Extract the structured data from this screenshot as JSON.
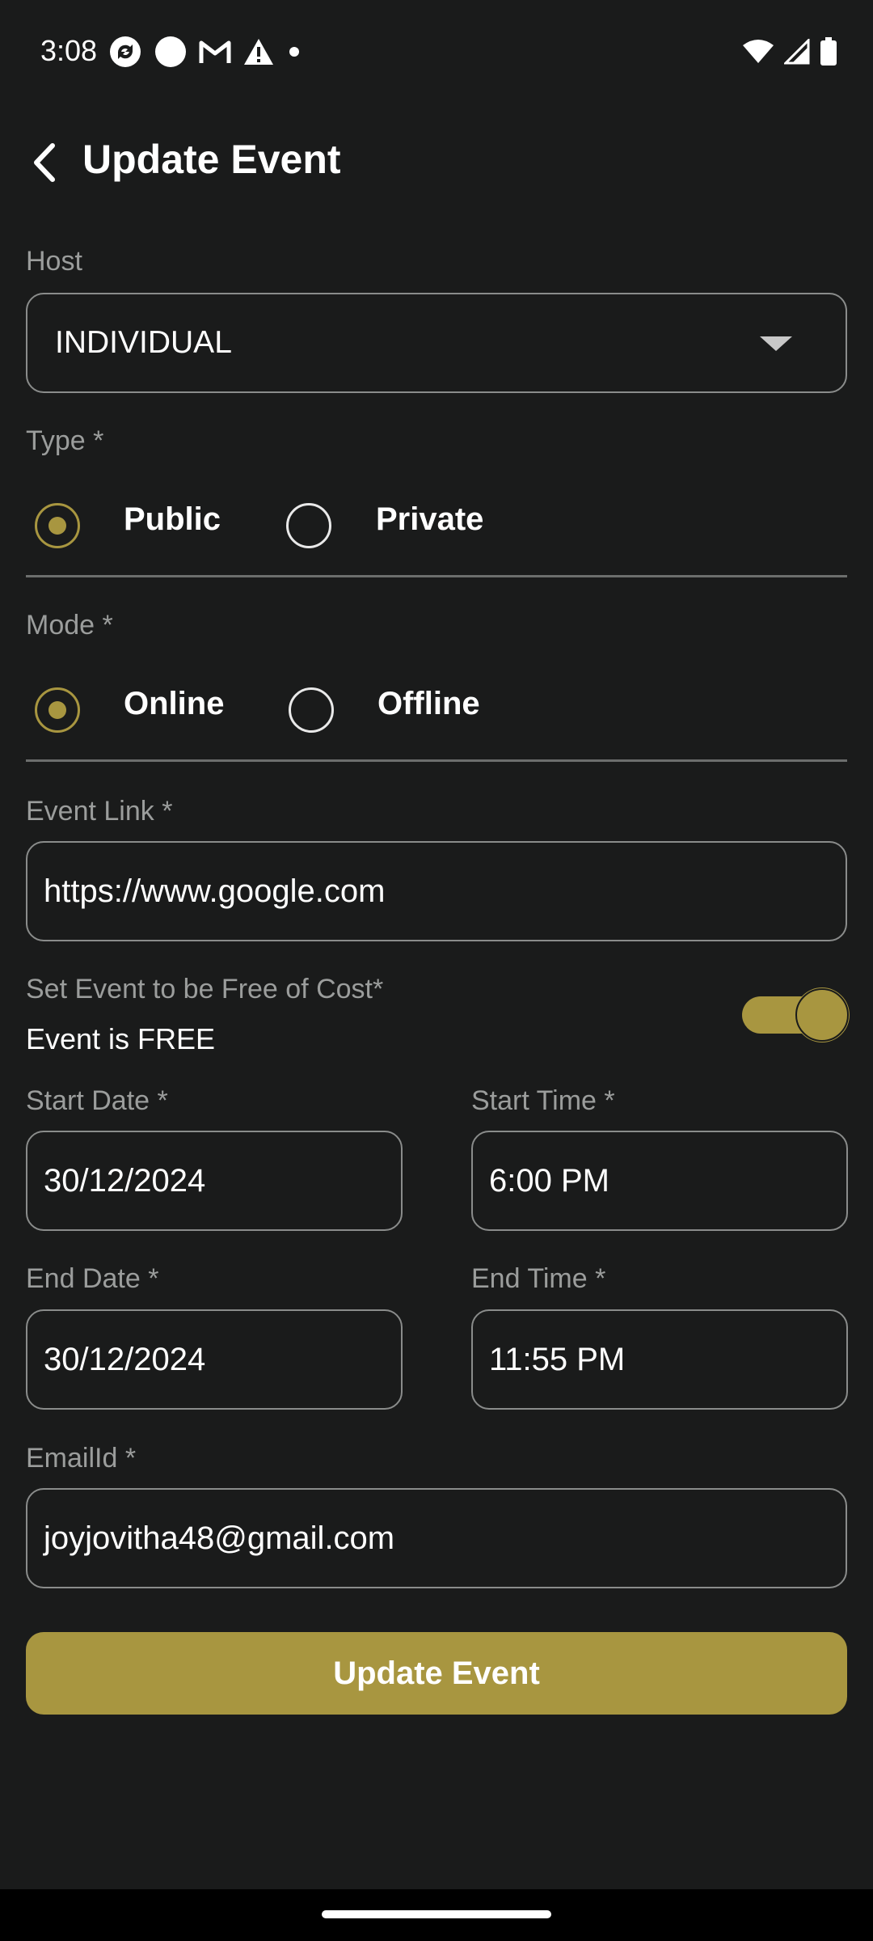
{
  "status_bar": {
    "time": "3:08",
    "left_icons": [
      "sync-icon",
      "circle-icon",
      "gmail-icon",
      "warning-icon",
      "dot-icon"
    ],
    "right_icons": [
      "wifi-icon",
      "signal-icon",
      "battery-icon"
    ]
  },
  "header": {
    "title": "Update Event",
    "back_icon": "chevron-left-icon"
  },
  "form": {
    "host": {
      "label": "Host",
      "value": "INDIVIDUAL"
    },
    "type": {
      "label": "Type *",
      "options": [
        {
          "label": "Public",
          "checked": true
        },
        {
          "label": "Private",
          "checked": false
        }
      ]
    },
    "mode": {
      "label": "Mode *",
      "options": [
        {
          "label": "Online",
          "checked": true
        },
        {
          "label": "Offline",
          "checked": false
        }
      ]
    },
    "event_link": {
      "label": "Event Link *",
      "value": "https://www.google.com"
    },
    "free_cost": {
      "label": "Set Event to be Free of Cost*",
      "status": "Event is FREE",
      "enabled": true
    },
    "start_date": {
      "label": "Start Date *",
      "value": "30/12/2024"
    },
    "start_time": {
      "label": "Start Time *",
      "value": "6:00 PM"
    },
    "end_date": {
      "label": "End Date *",
      "value": "30/12/2024"
    },
    "end_time": {
      "label": "End Time *",
      "value": "11:55 PM"
    },
    "email": {
      "label": "EmailId *",
      "value": "joyjovitha48@gmail.com"
    },
    "submit_label": "Update Event"
  },
  "colors": {
    "background": "#1a1b1b",
    "accent": "#a89640",
    "label": "#9b9d9c",
    "border": "#8a8c8b"
  }
}
